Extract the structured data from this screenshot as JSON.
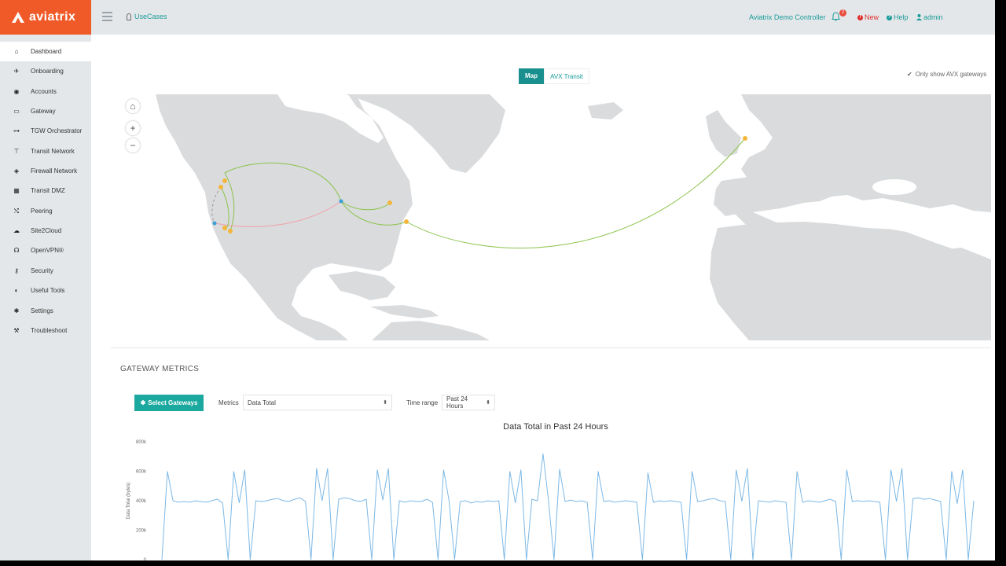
{
  "brand": {
    "name": "aviatrix"
  },
  "header": {
    "usecases": "UseCases",
    "controller": "Aviatrix Demo Controller",
    "notifications_count": "2",
    "new_label": "New",
    "help_label": "Help",
    "user": "admin"
  },
  "sidebar": {
    "items": [
      {
        "label": "Dashboard",
        "icon": "home-icon",
        "active": true
      },
      {
        "label": "Onboarding",
        "icon": "plane-icon"
      },
      {
        "label": "Accounts",
        "icon": "eye-icon"
      },
      {
        "label": "Gateway",
        "icon": "monitor-icon"
      },
      {
        "label": "TGW Orchestrator",
        "icon": "network-icon"
      },
      {
        "label": "Transit Network",
        "icon": "transit-icon"
      },
      {
        "label": "Firewall Network",
        "icon": "shield-icon"
      },
      {
        "label": "Transit DMZ",
        "icon": "building-icon"
      },
      {
        "label": "Peering",
        "icon": "shuffle-icon"
      },
      {
        "label": "Site2Cloud",
        "icon": "cloud-icon"
      },
      {
        "label": "OpenVPN®",
        "icon": "vpn-icon"
      },
      {
        "label": "Security",
        "icon": "key-icon"
      },
      {
        "label": "Useful Tools",
        "icon": "tools-icon"
      },
      {
        "label": "Settings",
        "icon": "gear-icon"
      },
      {
        "label": "Troubleshoot",
        "icon": "wrench-icon"
      }
    ]
  },
  "map": {
    "tabs": {
      "map": "Map",
      "avx_transit": "AVX Transit"
    },
    "only_avx_label": "Only show AVX gateways",
    "only_avx_checked": true
  },
  "metrics": {
    "section_title": "GATEWAY METRICS",
    "select_button": "Select Gateways",
    "metrics_label": "Metrics",
    "metrics_value": "Data Total",
    "time_label": "Time range",
    "time_value": "Past 24 Hours"
  },
  "chart_data": {
    "type": "line",
    "title": "Data Total in Past 24 Hours",
    "ylabel": "Data Total (bytes)",
    "xlabel": "",
    "ylim": [
      0,
      800000
    ],
    "yticks": [
      "0",
      "200k",
      "400k",
      "600k",
      "800k"
    ],
    "grid": false,
    "color": "#7cb8e6",
    "series": [
      {
        "values": [
          0,
          600000,
          400000,
          390000,
          395000,
          390000,
          400000,
          395000,
          390000,
          400000,
          410000,
          385000,
          0,
          600000,
          385000,
          610000,
          0,
          400000,
          395000,
          400000,
          410000,
          415000,
          400000,
          395000,
          410000,
          420000,
          395000,
          0,
          620000,
          400000,
          620000,
          0,
          410000,
          420000,
          415000,
          400000,
          395000,
          410000,
          0,
          610000,
          405000,
          620000,
          0,
          400000,
          390000,
          400000,
          395000,
          395000,
          410000,
          390000,
          0,
          610000,
          400000,
          0,
          395000,
          400000,
          385000,
          395000,
          390000,
          400000,
          395000,
          400000,
          0,
          600000,
          385000,
          610000,
          0,
          410000,
          400000,
          720000,
          400000,
          0,
          615000,
          395000,
          405000,
          395000,
          400000,
          390000,
          0,
          600000,
          395000,
          400000,
          390000,
          395000,
          400000,
          395000,
          390000,
          0,
          590000,
          390000,
          400000,
          395000,
          400000,
          395000,
          390000,
          0,
          600000,
          395000,
          400000,
          410000,
          415000,
          400000,
          395000,
          0,
          610000,
          395000,
          620000,
          0,
          400000,
          395000,
          390000,
          400000,
          395000,
          390000,
          0,
          600000,
          390000,
          400000,
          395000,
          390000,
          400000,
          410000,
          395000,
          0,
          610000,
          395000,
          400000,
          395000,
          400000,
          395000,
          390000,
          0,
          610000,
          395000,
          620000,
          0,
          415000,
          420000,
          410000,
          415000,
          405000,
          395000,
          0,
          600000,
          380000,
          610000,
          0,
          400000
        ]
      }
    ]
  }
}
